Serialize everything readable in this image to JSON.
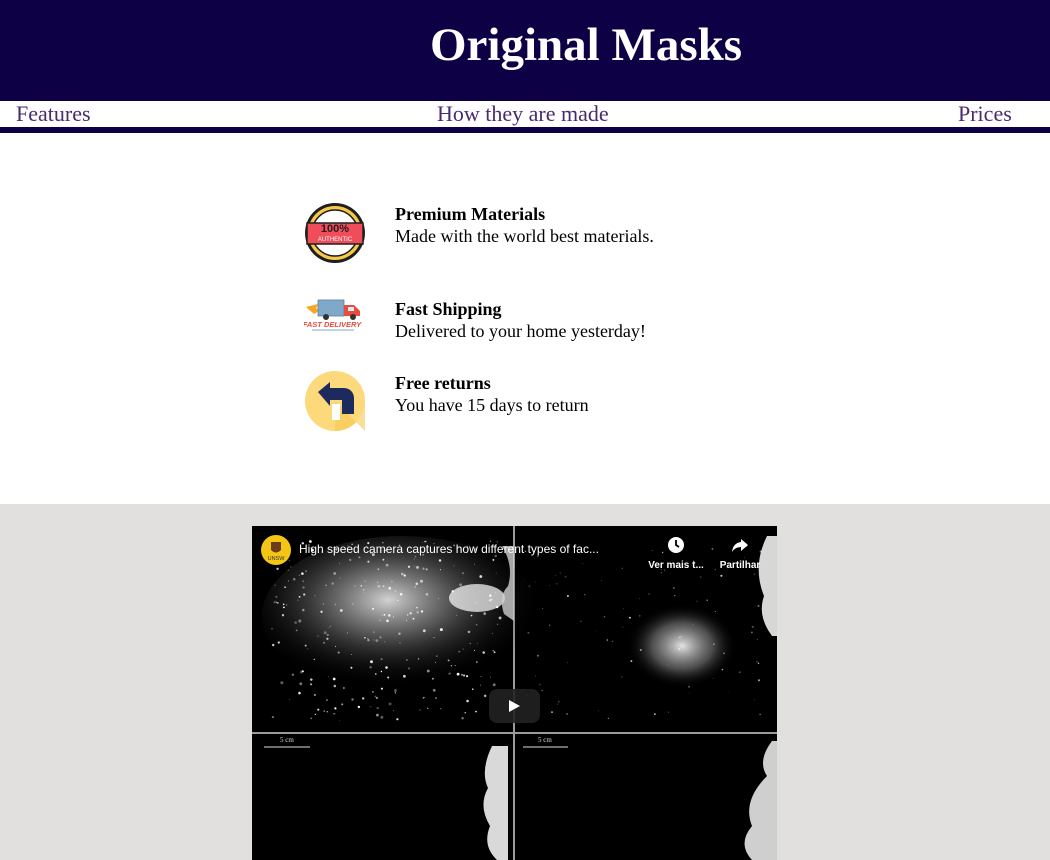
{
  "header": {
    "title": "Original Masks"
  },
  "nav": {
    "features": "Features",
    "how_made": "How they are made",
    "prices": "Prices"
  },
  "features": [
    {
      "icon": "authentic-badge-icon",
      "badge_top": "100%",
      "badge_bottom": "AUTHENTIC",
      "title": "Premium Materials",
      "desc": "Made with the world best materials."
    },
    {
      "icon": "delivery-truck-icon",
      "badge_text": "FAST DELIVERY",
      "title": "Fast Shipping",
      "desc": "Delivered to your home yesterday!"
    },
    {
      "icon": "return-arrow-icon",
      "title": "Free returns",
      "desc": "You have 15 days to return"
    }
  ],
  "video": {
    "title": "High speed camera captures how different types of fac...",
    "channel_label": "UNSW",
    "watch_later": "Ver mais t...",
    "share": "Partilhar",
    "scale_label": "5 cm"
  },
  "colors": {
    "header_bg": "#0e0044",
    "nav_text": "#4a2a6e",
    "video_section_bg": "#e2dfdf"
  }
}
